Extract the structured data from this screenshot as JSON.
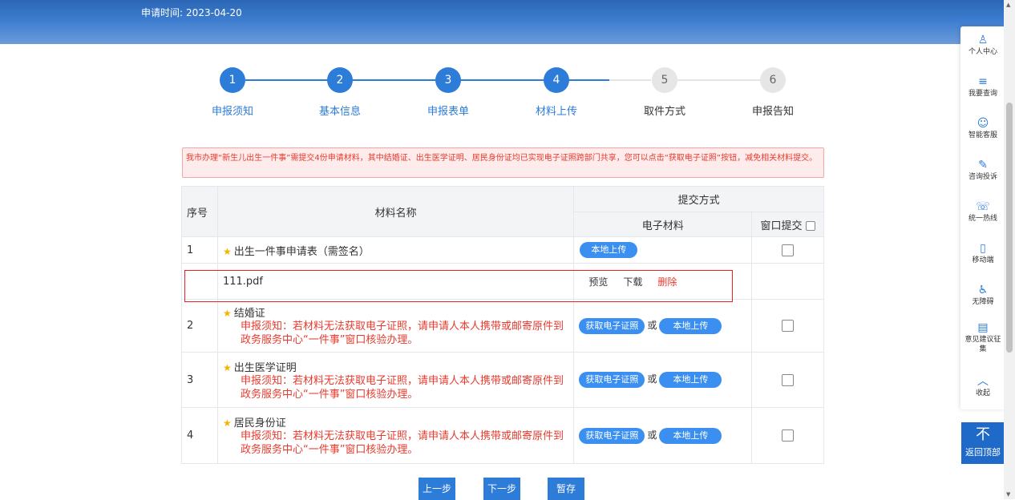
{
  "header": {
    "date_label": "申请时间:",
    "date_value": "2023-04-20"
  },
  "steps": [
    {
      "num": "1",
      "label": "申报须知"
    },
    {
      "num": "2",
      "label": "基本信息"
    },
    {
      "num": "3",
      "label": "申报表单"
    },
    {
      "num": "4",
      "label": "材料上传"
    },
    {
      "num": "5",
      "label": "取件方式"
    },
    {
      "num": "6",
      "label": "申报告知"
    }
  ],
  "notice": "我市办理“新生儿出生一件事”需提交4份申请材料，其中结婚证、出生医学证明、居民身份证均已实现电子证照跨部门共享，您可以点击“获取电子证照”按钮，减免相关材料提交。",
  "table": {
    "col_seq": "序号",
    "col_name": "材料名称",
    "col_submit": "提交方式",
    "col_electronic": "电子材料",
    "col_window": "窗口提交",
    "rows": [
      {
        "seq": "1",
        "name": "出生一件事申请表（需签名）",
        "upload": "本地上传"
      },
      {
        "seq": "2",
        "name": "结婚证",
        "warn": "申报须知：若材料无法获取电子证照，请申请人本人携带或邮寄原件到政务服务中心“一件事”窗口核验办理。",
        "get": "获取电子证照",
        "or": "或",
        "upload": "本地上传"
      },
      {
        "seq": "3",
        "name": "出生医学证明",
        "warn": "申报须知：若材料无法获取电子证照，请申请人本人携带或邮寄原件到政务服务中心“一件事”窗口核验办理。",
        "get": "获取电子证照",
        "or": "或",
        "upload": "本地上传"
      },
      {
        "seq": "4",
        "name": "居民身份证",
        "warn": "申报须知：若材料无法获取电子证照，请申请人本人携带或邮寄原件到政务服务中心“一件事”窗口核验办理。",
        "get": "获取电子证照",
        "or": "或",
        "upload": "本地上传"
      }
    ],
    "file": {
      "name": "111.pdf",
      "preview": "预览",
      "download": "下载",
      "delete": "删除"
    }
  },
  "buttons": {
    "prev": "上一步",
    "next": "下一步",
    "save": "暂存"
  },
  "rail": [
    {
      "icon": "user-icon",
      "glyph": "♙",
      "label": "个人中心"
    },
    {
      "icon": "search-list-icon",
      "glyph": "≡",
      "label": "我要查询"
    },
    {
      "icon": "service-icon",
      "glyph": "☺",
      "label": "智能客服"
    },
    {
      "icon": "edit-icon",
      "glyph": "✎",
      "label": "咨询投诉"
    },
    {
      "icon": "phone-icon",
      "glyph": "☏",
      "label": "统一热线"
    },
    {
      "icon": "mobile-icon",
      "glyph": "▯",
      "label": "移动端"
    },
    {
      "icon": "accessibility-icon",
      "glyph": "♿",
      "label": "无障碍"
    },
    {
      "icon": "feedback-icon",
      "glyph": "▤",
      "label": "意见建议征集"
    },
    {
      "icon": "chevron-up-icon",
      "glyph": "︿",
      "label": "收起"
    }
  ],
  "back_top": {
    "arrow": "不",
    "label": "返回顶部"
  },
  "colors": {
    "primary": "#2d7cd8",
    "danger": "#e63b2e",
    "inactive": "#e6e6e6"
  }
}
